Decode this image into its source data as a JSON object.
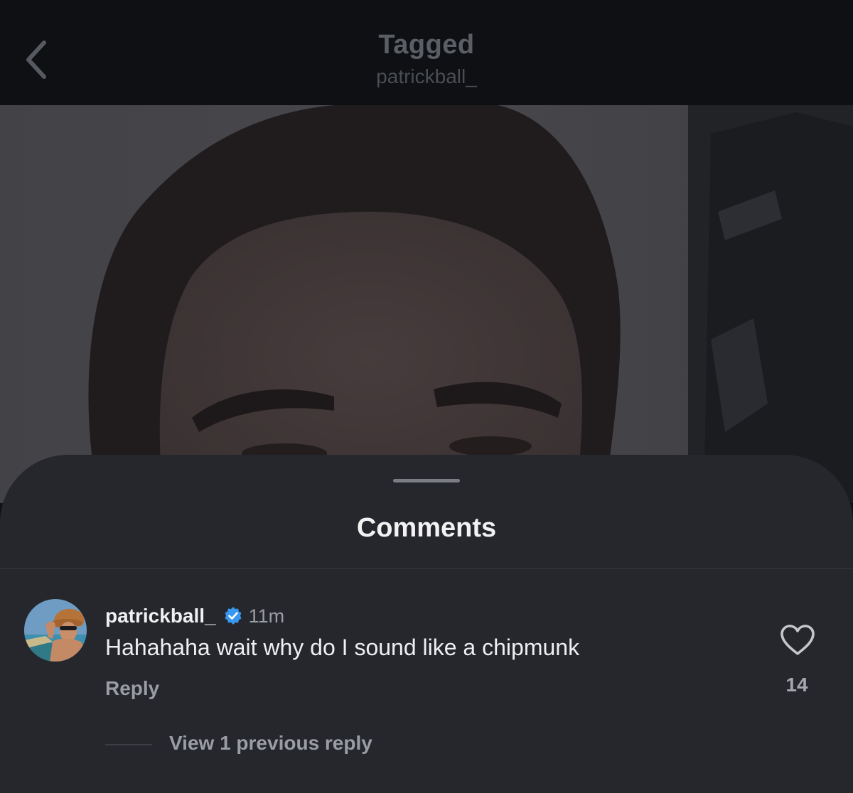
{
  "header": {
    "title": "Tagged",
    "subtitle": "patrickball_",
    "back_icon": "chevron-left-icon"
  },
  "comments_sheet": {
    "title": "Comments",
    "comment": {
      "username": "patrickball_",
      "verified": true,
      "verified_icon": "verified-badge-icon",
      "timestamp": "11m",
      "text": "Hahahaha wait why do I sound like a chipmunk",
      "reply_label": "Reply",
      "like_icon": "heart-outline-icon",
      "like_count": "14",
      "view_replies_label": "View 1 previous reply"
    }
  },
  "colors": {
    "header_bg": "#0e1014",
    "sheet_bg": "#25272c",
    "verified_blue": "#3897f0",
    "primary_text": "#f0f0f2",
    "secondary_text": "#9a9da3"
  }
}
